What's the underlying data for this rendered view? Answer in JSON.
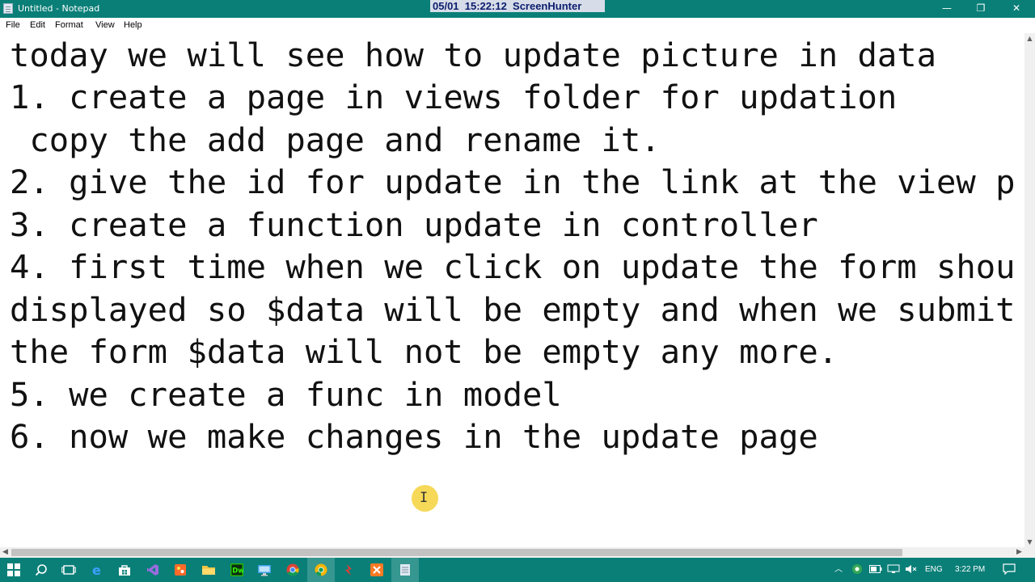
{
  "window": {
    "title": "Untitled - Notepad",
    "overlay_text": "05/01  15:22:12  ScreenHunter",
    "minimize_glyph": "—",
    "restore_glyph": "❐",
    "close_glyph": "✕"
  },
  "menu": [
    "File",
    "Edit",
    "Format",
    "View",
    "Help"
  ],
  "editor": {
    "lines": [
      "today we will see how to update picture in data",
      "1. create a page in views folder for updation",
      " copy the add page and rename it.",
      "2. give the id for update in the link at the view p",
      "3. create a function update in controller",
      "4. first time when we click on update the form shou",
      "displayed so $data will be empty and when we submit",
      "the form $data will not be empty any more.",
      "5. we create a func in model",
      "6. now we make changes in the update page"
    ]
  },
  "taskbar": {
    "icons": [
      "start-icon",
      "search-icon",
      "task-view-icon",
      "edge-icon",
      "store-icon",
      "visual-studio-icon",
      "paint-icon",
      "file-explorer-icon",
      "dreamweaver-icon",
      "remote-desktop-icon",
      "chrome-icon",
      "chrome-canary-icon",
      "filezilla-icon",
      "xampp-icon",
      "notepad-icon"
    ],
    "language": "ENG",
    "time": "3:22 PM"
  },
  "colors": {
    "titlebar": "#0a7f78",
    "taskbar": "#0a7f78",
    "editor_text": "#111111",
    "cursor_highlight": "#f5d23c"
  }
}
